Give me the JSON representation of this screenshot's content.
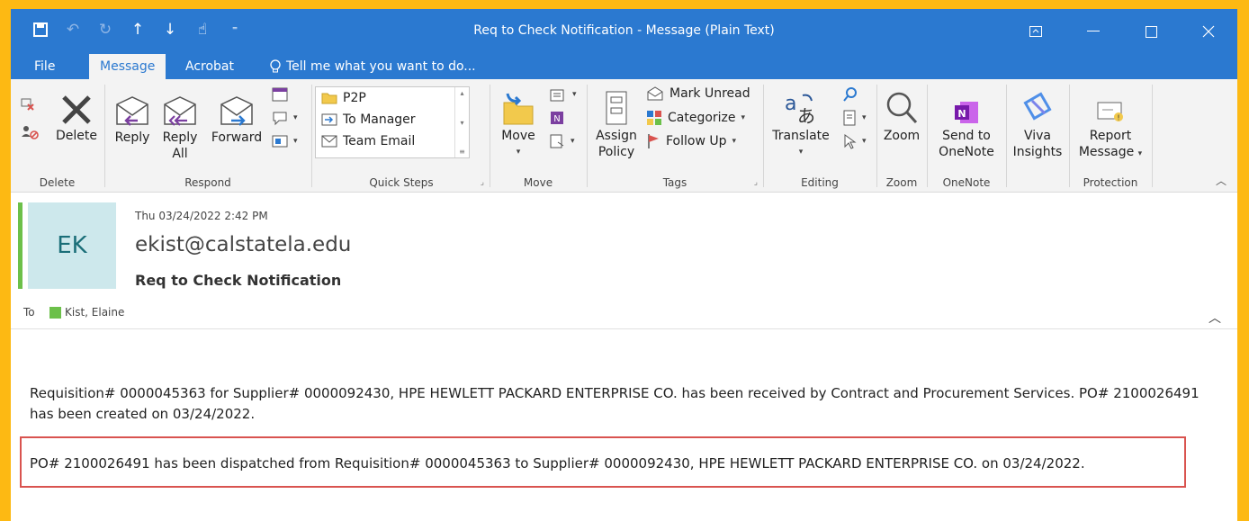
{
  "window": {
    "title": "Req to Check Notification - Message (Plain Text)"
  },
  "tabs": [
    {
      "label": "File"
    },
    {
      "label": "Message"
    },
    {
      "label": "Acrobat"
    },
    {
      "label": "Tell me what you want to do..."
    }
  ],
  "ribbon": {
    "delete": {
      "group_label": "Delete",
      "delete_label": "Delete"
    },
    "respond": {
      "group_label": "Respond",
      "reply": "Reply",
      "reply_all_1": "Reply",
      "reply_all_2": "All",
      "forward": "Forward"
    },
    "quick_steps": {
      "group_label": "Quick Steps",
      "items": [
        "P2P",
        "To Manager",
        "Team Email"
      ]
    },
    "move": {
      "group_label": "Move",
      "move_label": "Move"
    },
    "tags": {
      "group_label": "Tags",
      "assign_1": "Assign",
      "assign_2": "Policy",
      "mark_unread": "Mark Unread",
      "categorize": "Categorize",
      "follow_up": "Follow Up"
    },
    "editing": {
      "group_label": "Editing",
      "translate": "Translate"
    },
    "zoom": {
      "group_label": "Zoom",
      "zoom_label": "Zoom"
    },
    "onenote": {
      "group_label": "OneNote",
      "send_1": "Send to",
      "send_2": "OneNote"
    },
    "viva": {
      "label_1": "Viva",
      "label_2": "Insights"
    },
    "protection": {
      "group_label": "Protection",
      "report_1": "Report",
      "report_2": "Message"
    }
  },
  "message": {
    "date": "Thu 03/24/2022 2:42 PM",
    "avatar_initials": "EK",
    "sender": "ekist@calstatela.edu",
    "subject": "Req to Check Notification",
    "to_label": "To",
    "recipient": "Kist, Elaine",
    "body_p1": "Requisition# 0000045363 for Supplier# 0000092430, HPE HEWLETT PACKARD ENTERPRISE CO. has been received by Contract and Procurement Services.  PO# 2100026491 has been created on 03/24/2022.",
    "body_p2": "PO# 2100026491 has been dispatched from Requisition# 0000045363 to Supplier# 0000092430, HPE HEWLETT PACKARD ENTERPRISE CO. on 03/24/2022."
  },
  "colors": {
    "titlebar": "#2B79D0",
    "border": "#FDB913",
    "highlight_box": "#D9534F",
    "presence": "#6CC04A"
  }
}
